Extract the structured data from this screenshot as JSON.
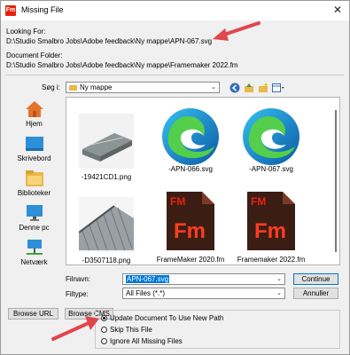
{
  "window": {
    "title": "Missing File",
    "app_icon_text": "Fm",
    "close_glyph": "✕"
  },
  "looking_for": {
    "label": "Looking For:",
    "value": "D:\\Studio Smalbro Jobs\\Adobe feedback\\Ny mappe\\APN-067.svg"
  },
  "document_folder": {
    "label": "Document Folder:",
    "value": "D:\\Studio Smalbro Jobs\\Adobe feedback\\Ny mappe\\Framemaker 2022.fm"
  },
  "search": {
    "label": "Søg i:",
    "current_folder": "Ny mappe"
  },
  "places": [
    {
      "label": "Hjem",
      "icon": "home-icon"
    },
    {
      "label": "Skrivebord",
      "icon": "desktop-icon"
    },
    {
      "label": "Biblioteker",
      "icon": "libraries-icon"
    },
    {
      "label": "Denne pc",
      "icon": "computer-icon"
    },
    {
      "label": "Netværk",
      "icon": "network-icon"
    }
  ],
  "files": [
    {
      "name": "-19421CD1.png",
      "type": "image-file"
    },
    {
      "name": "-APN-066.svg",
      "type": "edge-svg-file"
    },
    {
      "name": "-APN-067.svg",
      "type": "edge-svg-file"
    },
    {
      "name": "-D3507118.png",
      "type": "image-file"
    },
    {
      "name": "FrameMaker 2020.fm",
      "type": "framemaker-file",
      "badge": "Fm",
      "top_badge": "FM"
    },
    {
      "name": "Framemaker 2022.fm",
      "type": "framemaker-file",
      "badge": "Fm",
      "top_badge": "FM"
    }
  ],
  "filename": {
    "label": "Filnavn:",
    "value": "APN-067.svg"
  },
  "filetype": {
    "label": "Filtype:",
    "value": "All Files (*.*)"
  },
  "buttons": {
    "continue": "Continue",
    "cancel": "Annuller",
    "browse_url": "Browse URL",
    "browse_cms": "Browse CMS"
  },
  "options": [
    {
      "label": "Update Document To Use New Path",
      "selected": true
    },
    {
      "label": "Skip This File",
      "selected": false
    },
    {
      "label": "Ignore All Missing Files",
      "selected": false
    }
  ],
  "colors": {
    "annotation_arrow": "#e0464e",
    "fm_brand": "#e8210d",
    "selection": "#0078d7"
  }
}
